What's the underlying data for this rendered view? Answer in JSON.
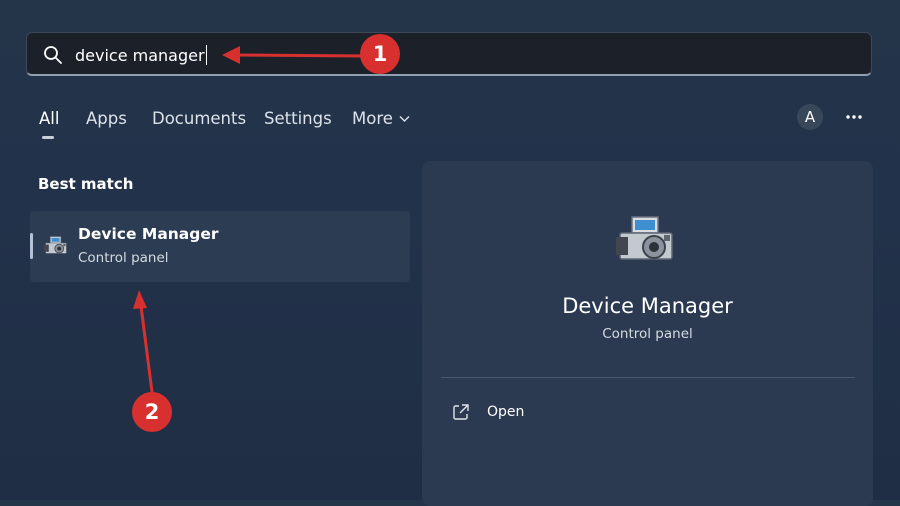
{
  "search": {
    "query": "device manager",
    "icon": "search-icon"
  },
  "tabs": [
    {
      "label": "All",
      "active": true
    },
    {
      "label": "Apps"
    },
    {
      "label": "Documents"
    },
    {
      "label": "Settings"
    },
    {
      "label": "More",
      "icon": "chevron-down-icon"
    }
  ],
  "account": {
    "avatar_letter": "A",
    "more_icon": "ellipsis-icon"
  },
  "results": {
    "section_title": "Best match",
    "items": [
      {
        "title": "Device Manager",
        "subtitle": "Control panel",
        "icon": "device-manager-icon"
      }
    ]
  },
  "preview": {
    "title": "Device Manager",
    "subtitle": "Control panel",
    "actions": [
      {
        "label": "Open",
        "icon": "open-external-icon"
      }
    ]
  },
  "annotations": {
    "markers": [
      "1",
      "2"
    ],
    "color": "#d8302f"
  },
  "colors": {
    "background": "#22324a",
    "panel": "#2b3a50",
    "search_box": "#1c2129",
    "selected_item": "#2c3c52"
  }
}
